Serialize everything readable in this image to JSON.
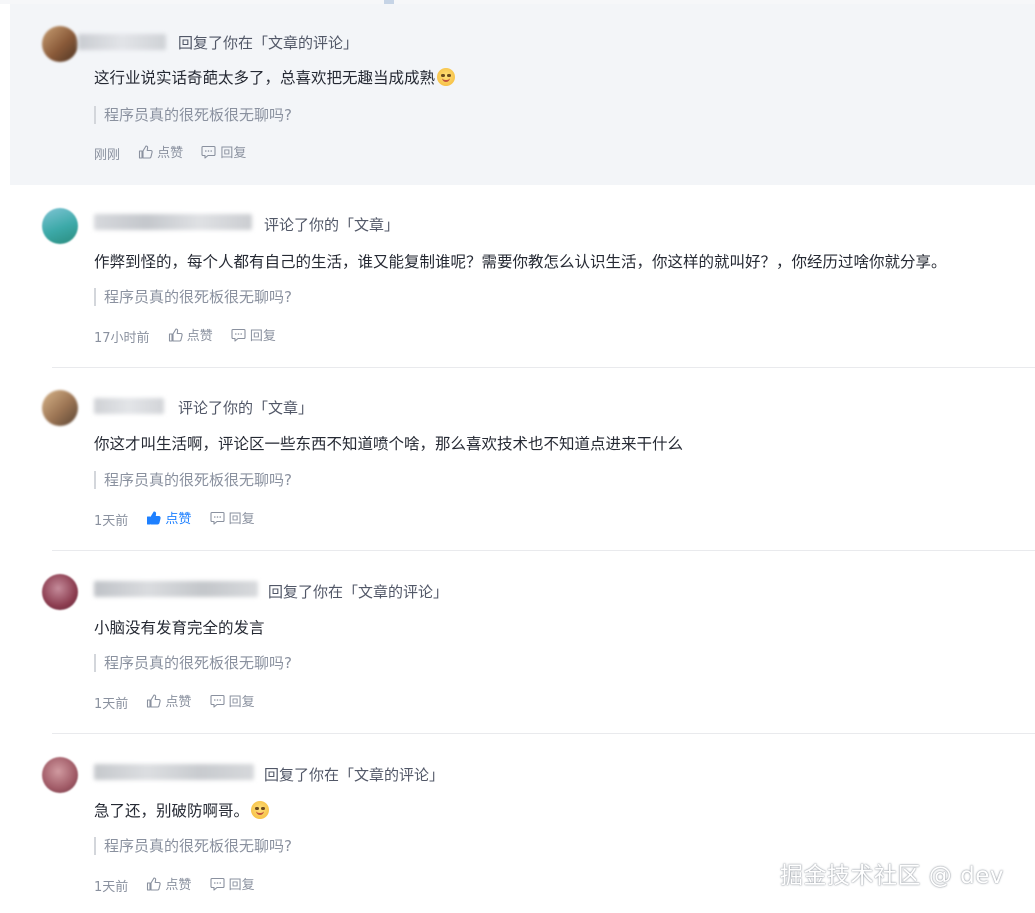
{
  "notifications": [
    {
      "action": "回复了你在「文章的评论」",
      "content": "这行业说实话奇葩太多了，总喜欢把无趣当成成熟",
      "emoji": "smiling-face-icon",
      "quote": "程序员真的很死板很无聊吗?",
      "time": "刚刚",
      "like_label": "点赞",
      "reply_label": "回复",
      "liked": false,
      "highlighted": true
    },
    {
      "action": "评论了你的「文章」",
      "content": "作弊到怪的，每个人都有自己的生活，谁又能复制谁呢？需要你教怎么认识生活，你这样的就叫好？，你经历过啥你就分享。",
      "quote": "程序员真的很死板很无聊吗?",
      "time": "17小时前",
      "like_label": "点赞",
      "reply_label": "回复",
      "liked": false,
      "highlighted": false
    },
    {
      "action": "评论了你的「文章」",
      "content": "你这才叫生活啊，评论区一些东西不知道喷个啥，那么喜欢技术也不知道点进来干什么",
      "quote": "程序员真的很死板很无聊吗?",
      "time": "1天前",
      "like_label": "点赞",
      "reply_label": "回复",
      "liked": true,
      "highlighted": false
    },
    {
      "action": "回复了你在「文章的评论」",
      "content": "小脑没有发育完全的发言",
      "quote": "程序员真的很死板很无聊吗?",
      "time": "1天前",
      "like_label": "点赞",
      "reply_label": "回复",
      "liked": false,
      "highlighted": false
    },
    {
      "action": "回复了你在「文章的评论」",
      "content": "急了还，别破防啊哥。",
      "emoji": "smiling-face-icon",
      "quote": "程序员真的很死板很无聊吗?",
      "time": "1天前",
      "like_label": "点赞",
      "reply_label": "回复",
      "liked": false,
      "highlighted": false
    }
  ],
  "watermark": "掘金技术社区 @ dev",
  "colors": {
    "accent": "#1e80ff",
    "highlight_bg": "#f3f5f8",
    "muted_text": "#8a919f"
  }
}
